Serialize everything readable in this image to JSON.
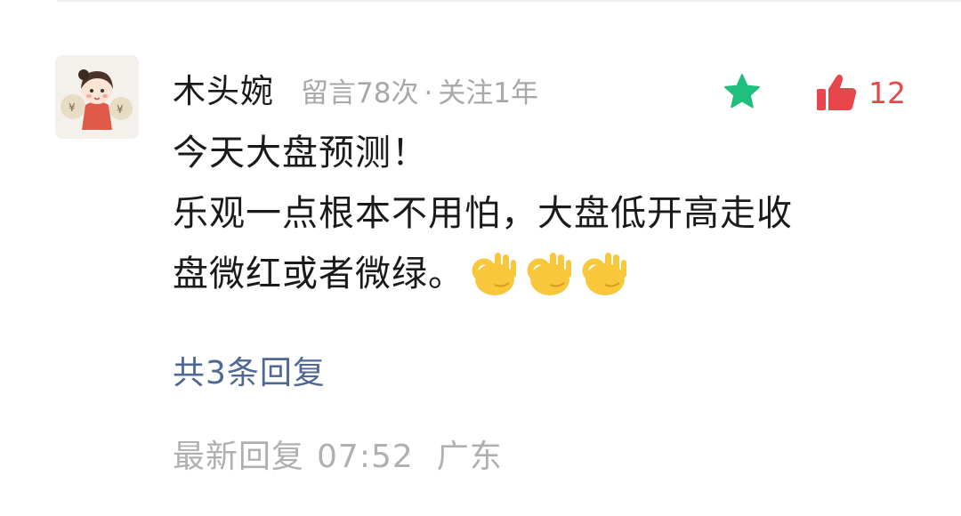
{
  "comment": {
    "author": {
      "name": "木头婉",
      "message_count": "留言78次",
      "separator": "·",
      "follow_duration": "关注1年"
    },
    "actions": {
      "favorite_icon": "star-icon",
      "favorite_color": "#1fc07e",
      "like_icon": "thumbs-up-icon",
      "like_color": "#e8464a",
      "like_count": "12"
    },
    "body_lines": [
      "今天大盘预测！",
      "乐观一点根本不用怕，大盘低开高走收",
      "盘微红或者微绿。"
    ],
    "emoji": [
      "ok-hand-emoji",
      "ok-hand-emoji",
      "ok-hand-emoji"
    ],
    "replies_link": "共3条回复",
    "latest_reply": {
      "label": "最新回复",
      "time": "07:52",
      "location": "广东"
    }
  }
}
